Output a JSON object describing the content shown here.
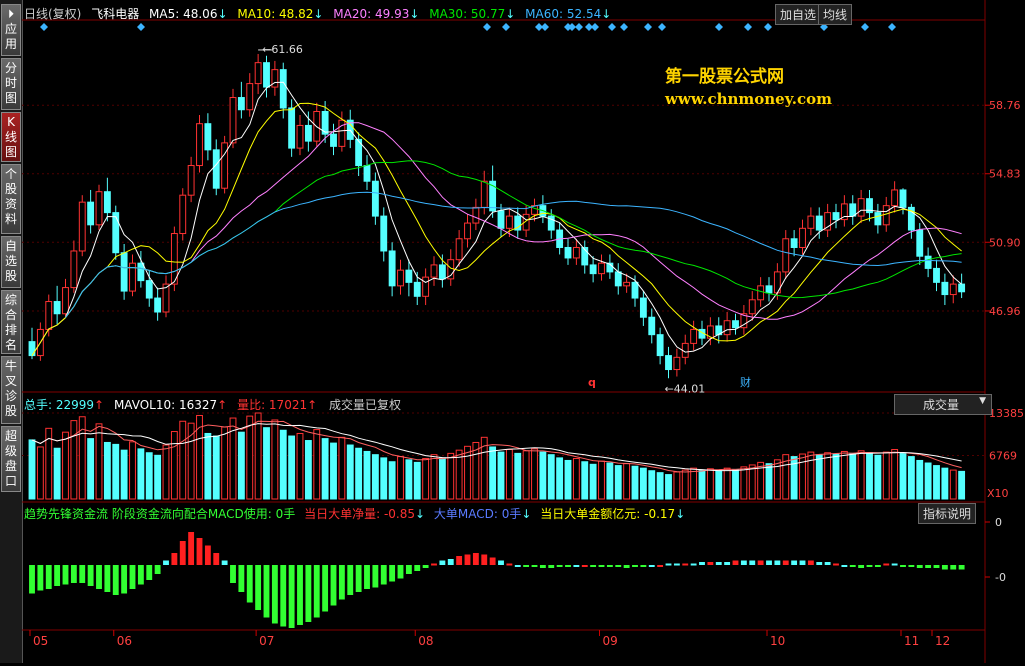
{
  "sidebar": {
    "items": [
      {
        "label": "应用",
        "icon": "play-icon"
      },
      {
        "label": "分时图"
      },
      {
        "label": "K线图"
      },
      {
        "label": "个股资料"
      },
      {
        "label": "自选股"
      },
      {
        "label": "综合排名"
      },
      {
        "label": "牛叉诊股"
      },
      {
        "label": "超级盘口"
      }
    ]
  },
  "header": {
    "period": "日线(复权)",
    "stock": "飞科电器",
    "ma5": "MA5: 48.06",
    "ma10": "MA10: 48.82",
    "ma20": "MA20: 49.93",
    "ma30": "MA30: 50.77",
    "ma60": "MA60: 52.54",
    "btn_add": "加自选",
    "btn_avg": "均线"
  },
  "watermark": {
    "line1": "第一股票公式网",
    "line2": "www.chnmoney.com"
  },
  "price_axis": [
    "58.76",
    "54.83",
    "50.90",
    "46.96"
  ],
  "annotations": {
    "high": "61.66",
    "low": "44.01",
    "q_mark": "q",
    "cai_mark": "财"
  },
  "volume": {
    "total": "总手: 22999",
    "mavol": "MAVOL10: 16327",
    "ratio": "量比: 17021",
    "note": "成交量已复权",
    "dropdown": "成交量",
    "axis": [
      "13385",
      "6769"
    ],
    "x10": "X10"
  },
  "indicator": {
    "title": "趋势先锋资金流 阶段资金流向配合MACD使用: 0手",
    "net": "当日大单净量: -0.85",
    "macd": "大单MACD: 0手",
    "amount": "当日大单金额亿元: -0.17",
    "explain": "指标说明",
    "axis": [
      "0",
      "-0"
    ]
  },
  "months": [
    "05",
    "06",
    "07",
    "08",
    "09",
    "10",
    "11",
    "12"
  ],
  "colors": {
    "up": "#ff3232",
    "down": "#54ffff",
    "ma5": "#ffffff",
    "ma10": "#ffff00",
    "ma20": "#ff80ff",
    "ma30": "#00e600",
    "ma60": "#3cb4ff",
    "green_bar": "#32ff32",
    "red_bar": "#ff2020"
  },
  "chart_data": {
    "type": "candlestick",
    "candles": [
      [
        45.2,
        44.4,
        46.0,
        44.2
      ],
      [
        44.4,
        45.9,
        46.3,
        44.1
      ],
      [
        45.9,
        47.5,
        47.9,
        45.5
      ],
      [
        47.5,
        46.8,
        48.4,
        46.2
      ],
      [
        46.8,
        48.3,
        48.8,
        46.6
      ],
      [
        48.3,
        50.4,
        51.0,
        48.0
      ],
      [
        50.4,
        53.2,
        53.6,
        50.1
      ],
      [
        53.2,
        51.9,
        53.9,
        51.4
      ],
      [
        51.9,
        53.8,
        54.2,
        51.6
      ],
      [
        53.8,
        52.6,
        54.6,
        52.1
      ],
      [
        52.6,
        50.3,
        53.0,
        49.9
      ],
      [
        50.3,
        48.1,
        50.8,
        47.6
      ],
      [
        48.1,
        49.7,
        50.2,
        47.8
      ],
      [
        49.7,
        48.7,
        50.4,
        48.3
      ],
      [
        48.7,
        47.7,
        49.3,
        47.2
      ],
      [
        47.7,
        46.9,
        48.3,
        46.4
      ],
      [
        46.9,
        48.5,
        49.0,
        46.6
      ],
      [
        48.5,
        51.4,
        51.8,
        48.1
      ],
      [
        51.4,
        53.6,
        54.0,
        51.0
      ],
      [
        53.6,
        55.3,
        55.8,
        53.2
      ],
      [
        55.3,
        57.7,
        58.2,
        54.9
      ],
      [
        57.7,
        56.2,
        58.3,
        55.6
      ],
      [
        56.2,
        54.0,
        56.8,
        53.6
      ],
      [
        54.0,
        56.6,
        57.0,
        53.7
      ],
      [
        56.6,
        59.2,
        59.7,
        56.3
      ],
      [
        59.2,
        58.5,
        60.1,
        58.0
      ],
      [
        58.5,
        60.0,
        60.6,
        58.1
      ],
      [
        60.0,
        61.2,
        61.7,
        59.4
      ],
      [
        61.2,
        59.8,
        61.6,
        59.2
      ],
      [
        59.8,
        60.8,
        61.3,
        59.3
      ],
      [
        60.8,
        58.6,
        61.2,
        58.0
      ],
      [
        58.6,
        56.3,
        59.1,
        55.8
      ],
      [
        56.3,
        57.6,
        58.2,
        55.9
      ],
      [
        57.6,
        56.7,
        58.4,
        56.1
      ],
      [
        56.7,
        58.4,
        58.9,
        56.4
      ],
      [
        58.4,
        57.1,
        59.0,
        56.6
      ],
      [
        57.1,
        56.4,
        57.7,
        55.9
      ],
      [
        56.4,
        57.9,
        58.4,
        56.1
      ],
      [
        57.9,
        56.8,
        58.5,
        56.3
      ],
      [
        56.8,
        55.3,
        57.2,
        54.7
      ],
      [
        55.3,
        54.4,
        55.9,
        53.9
      ],
      [
        54.4,
        52.4,
        54.9,
        51.9
      ],
      [
        52.4,
        50.4,
        52.9,
        49.8
      ],
      [
        50.4,
        48.4,
        50.9,
        47.8
      ],
      [
        48.4,
        49.3,
        49.9,
        47.9
      ],
      [
        49.3,
        48.6,
        49.9,
        47.8
      ],
      [
        48.6,
        47.8,
        49.2,
        47.3
      ],
      [
        47.8,
        48.9,
        49.4,
        47.3
      ],
      [
        48.9,
        49.6,
        50.1,
        48.4
      ],
      [
        49.6,
        48.8,
        50.2,
        48.3
      ],
      [
        48.8,
        49.9,
        50.5,
        48.4
      ],
      [
        49.9,
        51.1,
        51.6,
        49.5
      ],
      [
        51.1,
        52.0,
        52.5,
        50.6
      ],
      [
        52.0,
        52.9,
        53.4,
        51.6
      ],
      [
        52.9,
        54.4,
        55.0,
        52.5
      ],
      [
        54.4,
        52.7,
        55.3,
        52.3
      ],
      [
        52.7,
        51.7,
        53.1,
        51.2
      ],
      [
        51.7,
        52.4,
        52.9,
        51.2
      ],
      [
        52.4,
        51.6,
        52.9,
        51.1
      ],
      [
        51.6,
        52.5,
        53.0,
        51.2
      ],
      [
        52.5,
        53.0,
        53.4,
        52.1
      ],
      [
        53.0,
        52.4,
        53.6,
        52.0
      ],
      [
        52.4,
        51.6,
        52.8,
        51.1
      ],
      [
        51.6,
        50.6,
        52.0,
        50.2
      ],
      [
        50.6,
        50.0,
        51.1,
        49.6
      ],
      [
        50.0,
        50.6,
        51.1,
        49.6
      ],
      [
        50.6,
        49.6,
        51.0,
        49.1
      ],
      [
        49.6,
        49.1,
        50.1,
        48.6
      ],
      [
        49.1,
        49.7,
        50.2,
        48.7
      ],
      [
        49.7,
        49.2,
        50.2,
        48.8
      ],
      [
        49.2,
        48.4,
        49.7,
        47.9
      ],
      [
        48.4,
        48.6,
        49.1,
        48.0
      ],
      [
        48.6,
        47.7,
        49.0,
        47.2
      ],
      [
        47.7,
        46.6,
        48.1,
        46.1
      ],
      [
        46.6,
        45.6,
        47.1,
        45.1
      ],
      [
        45.6,
        44.4,
        46.0,
        43.9
      ],
      [
        44.4,
        43.6,
        44.9,
        43.1
      ],
      [
        43.6,
        44.3,
        44.8,
        43.2
      ],
      [
        44.3,
        45.1,
        45.6,
        43.9
      ],
      [
        45.1,
        45.9,
        46.4,
        44.7
      ],
      [
        45.9,
        45.4,
        46.4,
        45.0
      ],
      [
        45.4,
        46.1,
        46.6,
        45.0
      ],
      [
        46.1,
        45.6,
        46.6,
        45.1
      ],
      [
        45.6,
        46.4,
        46.9,
        45.2
      ],
      [
        46.4,
        46.0,
        46.8,
        45.6
      ],
      [
        46.0,
        46.8,
        47.3,
        45.6
      ],
      [
        46.8,
        47.6,
        48.1,
        46.4
      ],
      [
        47.6,
        48.4,
        48.9,
        47.2
      ],
      [
        48.4,
        48.0,
        48.9,
        47.5
      ],
      [
        48.0,
        49.2,
        49.7,
        47.6
      ],
      [
        49.2,
        51.1,
        51.6,
        48.8
      ],
      [
        51.1,
        50.6,
        51.6,
        50.1
      ],
      [
        50.6,
        51.7,
        52.2,
        50.2
      ],
      [
        51.7,
        52.4,
        52.9,
        51.3
      ],
      [
        52.4,
        51.6,
        52.9,
        51.1
      ],
      [
        51.6,
        52.6,
        53.1,
        51.2
      ],
      [
        52.6,
        52.2,
        53.1,
        51.7
      ],
      [
        52.2,
        53.1,
        53.6,
        51.8
      ],
      [
        53.1,
        52.4,
        53.6,
        51.9
      ],
      [
        52.4,
        53.4,
        53.9,
        52.0
      ],
      [
        53.4,
        52.6,
        53.9,
        52.1
      ],
      [
        52.6,
        51.9,
        53.1,
        51.4
      ],
      [
        51.9,
        53.0,
        53.5,
        51.5
      ],
      [
        53.0,
        53.9,
        54.4,
        52.6
      ],
      [
        53.9,
        52.9,
        54.0,
        52.5
      ],
      [
        52.9,
        51.6,
        53.1,
        51.1
      ],
      [
        51.6,
        50.1,
        52.0,
        49.6
      ],
      [
        50.1,
        49.4,
        50.6,
        48.9
      ],
      [
        49.4,
        48.6,
        49.9,
        48.1
      ],
      [
        48.6,
        47.9,
        49.1,
        47.3
      ],
      [
        47.9,
        48.5,
        49.0,
        47.4
      ],
      [
        48.5,
        48.06,
        49.1,
        47.7
      ]
    ],
    "volume": [
      9200,
      8100,
      11000,
      7900,
      10400,
      12200,
      12800,
      9400,
      11700,
      8800,
      8500,
      7600,
      8900,
      7800,
      7200,
      6800,
      8400,
      10500,
      12100,
      11800,
      13000,
      10200,
      9800,
      11200,
      12600,
      10400,
      12900,
      13385,
      11100,
      12300,
      10700,
      9800,
      10200,
      9100,
      10800,
      9400,
      8700,
      9600,
      8400,
      7900,
      7400,
      6900,
      6400,
      5800,
      6600,
      6100,
      5700,
      6300,
      6900,
      6400,
      7100,
      7600,
      8200,
      8800,
      9600,
      8100,
      7300,
      7700,
      7100,
      7500,
      7800,
      7300,
      6900,
      6400,
      6000,
      6300,
      5800,
      5400,
      5900,
      5600,
      5200,
      5500,
      5100,
      4800,
      4400,
      4100,
      3800,
      4200,
      4500,
      4800,
      4500,
      4700,
      4400,
      4800,
      4600,
      5000,
      5300,
      5700,
      5500,
      6100,
      6900,
      6600,
      7000,
      7300,
      6900,
      7200,
      7000,
      7400,
      7100,
      7500,
      7200,
      6800,
      7300,
      7700,
      7100,
      6600,
      6000,
      5600,
      5200,
      4800,
      4500,
      4300
    ],
    "flow": [
      -1.9,
      -1.7,
      -1.6,
      -1.4,
      -1.3,
      -1.2,
      -1.2,
      -1.4,
      -1.6,
      -1.8,
      -2.0,
      -1.9,
      -1.6,
      -1.3,
      -1.0,
      -0.6,
      0.3,
      0.8,
      1.6,
      2.2,
      1.8,
      1.3,
      0.8,
      0.3,
      -1.2,
      -1.8,
      -2.5,
      -3.0,
      -3.5,
      -3.9,
      -4.1,
      -4.2,
      -4.0,
      -3.8,
      -3.5,
      -3.1,
      -2.7,
      -2.3,
      -2.0,
      -1.8,
      -1.6,
      -1.5,
      -1.3,
      -1.1,
      -0.9,
      -0.6,
      -0.4,
      -0.2,
      0.1,
      0.3,
      0.4,
      0.6,
      0.7,
      0.8,
      0.7,
      0.5,
      0.3,
      0.1,
      0.0,
      -0.1,
      -0.1,
      -0.2,
      -0.2,
      -0.1,
      -0.1,
      0.0,
      0.0,
      -0.1,
      -0.1,
      -0.1,
      -0.1,
      -0.2,
      -0.1,
      -0.1,
      0.0,
      0.0,
      0.1,
      0.1,
      0.1,
      0.1,
      0.2,
      0.2,
      0.2,
      0.2,
      0.3,
      0.3,
      0.3,
      0.3,
      0.3,
      0.3,
      0.3,
      0.3,
      0.3,
      0.3,
      0.2,
      0.2,
      0.1,
      0.0,
      -0.1,
      -0.2,
      -0.1,
      -0.1,
      0.1,
      0.1,
      -0.1,
      -0.1,
      -0.2,
      -0.2,
      -0.2,
      -0.3,
      -0.3,
      -0.3
    ],
    "ylim": [
      43.0,
      62.5
    ]
  }
}
